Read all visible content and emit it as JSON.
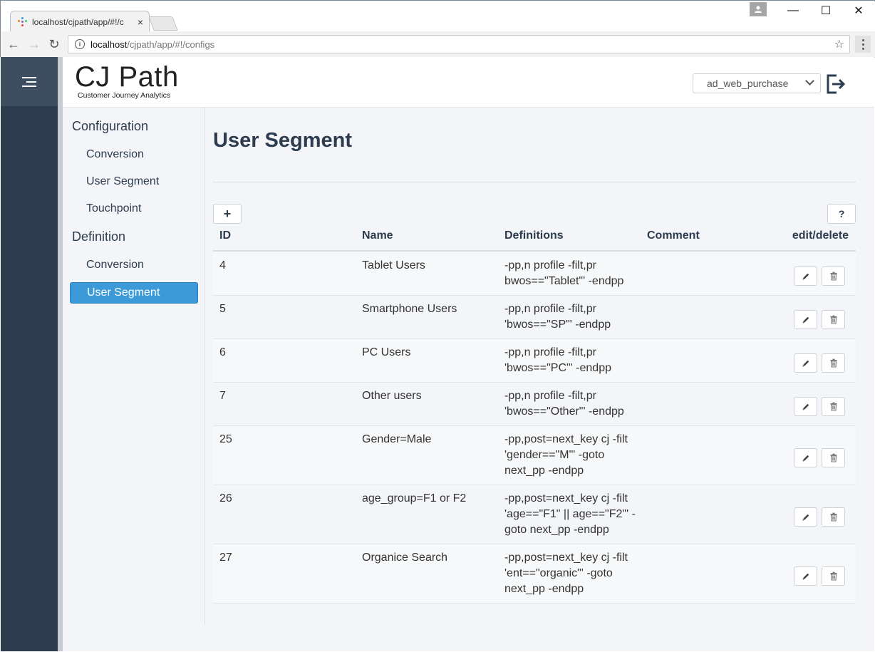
{
  "browser": {
    "tab_title": "localhost/cjpath/app/#!/c",
    "tab_close": "×",
    "url_host": "localhost",
    "url_path": "/cjpath/app/#!/configs",
    "back_glyph": "←",
    "forward_glyph": "→",
    "reload_glyph": "↻",
    "star_glyph": "☆",
    "info_glyph": "i",
    "minimize_glyph": "—",
    "maximize_glyph": "☐",
    "close_glyph": "✕"
  },
  "header": {
    "logo_title": "CJ Path",
    "logo_subtitle": "Customer Journey Analytics",
    "project_selected": "ad_web_purchase"
  },
  "sidenav": {
    "configuration_label": "Configuration",
    "configuration_items": [
      "Conversion",
      "User Segment",
      "Touchpoint"
    ],
    "definition_label": "Definition",
    "definition_items": [
      "Conversion",
      "User Segment"
    ],
    "active_item": "User Segment"
  },
  "main": {
    "title": "User Segment",
    "add_label": "+",
    "help_label": "?",
    "columns": {
      "id": "ID",
      "name": "Name",
      "definitions": "Definitions",
      "comment": "Comment",
      "actions": "edit/delete"
    },
    "rows": [
      {
        "id": "4",
        "name": "Tablet Users",
        "def_lines": [
          "-pp,n profile -filt,pr",
          "bwos==\"Tablet\"' -endpp"
        ],
        "comment": ""
      },
      {
        "id": "5",
        "name": "Smartphone Users",
        "def_lines": [
          "-pp,n profile -filt,pr",
          "'bwos==\"SP\"' -endpp"
        ],
        "comment": ""
      },
      {
        "id": "6",
        "name": "PC Users",
        "def_lines": [
          "-pp,n profile -filt,pr",
          "'bwos==\"PC\"' -endpp"
        ],
        "comment": ""
      },
      {
        "id": "7",
        "name": "Other users",
        "def_lines": [
          "-pp,n profile -filt,pr",
          "'bwos==\"Other\"' -endpp"
        ],
        "comment": ""
      },
      {
        "id": "25",
        "name": "Gender=Male",
        "def_lines": [
          "-pp,post=next_key cj -filt",
          "'gender==\"M\"' -goto",
          "next_pp -endpp"
        ],
        "comment": ""
      },
      {
        "id": "26",
        "name": "age_group=F1 or F2",
        "def_lines": [
          "-pp,post=next_key cj -filt",
          "'age==\"F1\" || age==\"F2\"' -",
          "goto next_pp -endpp"
        ],
        "comment": ""
      },
      {
        "id": "27",
        "name": "Organice Search",
        "def_lines": [
          "-pp,post=next_key cj -filt",
          "'ent==\"organic\"' -goto",
          "next_pp -endpp"
        ],
        "comment": ""
      }
    ]
  },
  "colors": {
    "rail": "#2d3d4f",
    "active": "#3c9ad9",
    "text": "#2d3d4f"
  }
}
